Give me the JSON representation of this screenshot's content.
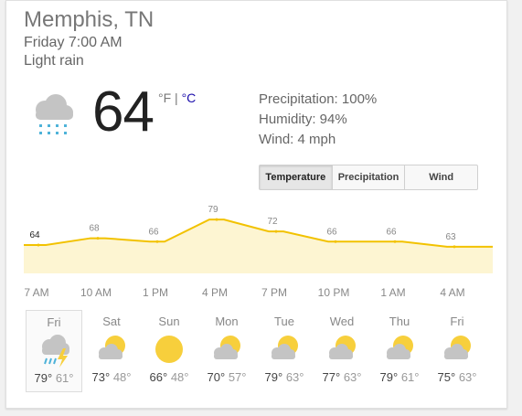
{
  "location": "Memphis, TN",
  "datetime": "Friday 7:00 AM",
  "condition": "Light rain",
  "current": {
    "temp": "64",
    "unit_f": "°F",
    "unit_sep": " | ",
    "unit_c": "°C",
    "icon": "rain-cloud-icon"
  },
  "details": {
    "precipitation": "Precipitation: 100%",
    "humidity": "Humidity: 94%",
    "wind": "Wind: 4 mph"
  },
  "tabs": [
    "Temperature",
    "Precipitation",
    "Wind"
  ],
  "active_tab": "Temperature",
  "colors": {
    "line": "#f2c200",
    "fill": "#fdf5d2",
    "link": "#1a0dab",
    "sun": "#f7cf3c",
    "cloud": "#c4c4c4",
    "rain": "#4fb3d9"
  },
  "chart_data": {
    "type": "area",
    "series": [
      {
        "values": [
          64,
          68,
          66,
          79,
          72,
          66,
          66,
          63
        ]
      }
    ],
    "labels": [
      "64",
      "68",
      "66",
      "79",
      "72",
      "66",
      "66",
      "63"
    ],
    "x": [
      "7 AM",
      "10 AM",
      "1 PM",
      "4 PM",
      "7 PM",
      "10 PM",
      "1 AM",
      "4 AM"
    ],
    "ylim": [
      50,
      85
    ]
  },
  "forecast": [
    {
      "day": "Fri",
      "icon": "rain-thunder-icon",
      "high": "79°",
      "low": "61°",
      "selected": true
    },
    {
      "day": "Sat",
      "icon": "partly-cloudy-icon",
      "high": "73°",
      "low": "48°"
    },
    {
      "day": "Sun",
      "icon": "sunny-icon",
      "high": "66°",
      "low": "48°"
    },
    {
      "day": "Mon",
      "icon": "partly-cloudy-icon",
      "high": "70°",
      "low": "57°"
    },
    {
      "day": "Tue",
      "icon": "partly-cloudy-icon",
      "high": "79°",
      "low": "63°"
    },
    {
      "day": "Wed",
      "icon": "partly-cloudy-icon",
      "high": "77°",
      "low": "63°"
    },
    {
      "day": "Thu",
      "icon": "partly-cloudy-icon",
      "high": "79°",
      "low": "61°"
    },
    {
      "day": "Fri",
      "icon": "partly-cloudy-icon",
      "high": "75°",
      "low": "63°"
    }
  ]
}
